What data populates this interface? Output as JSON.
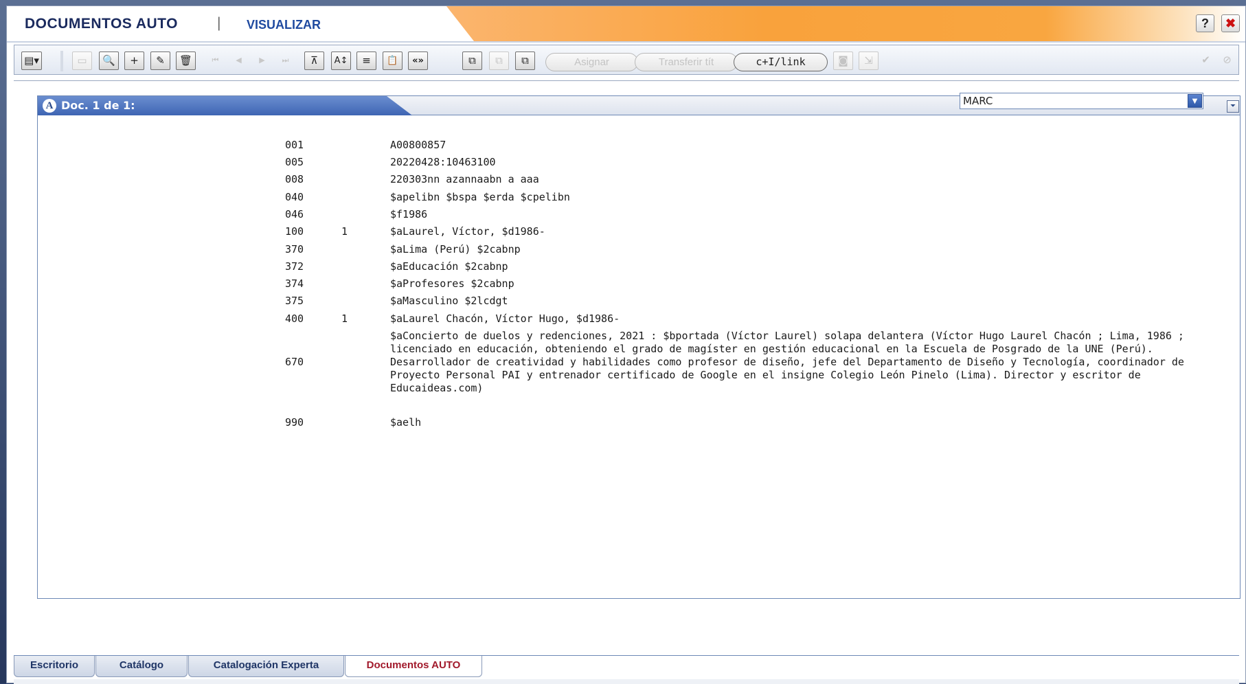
{
  "window": {
    "title": "DOCUMENTOS AUTO",
    "separator": "|",
    "mode": "VISUALIZAR",
    "help_label": "?",
    "close_label": "✖"
  },
  "toolbar": {
    "tools": [
      {
        "name": "view-menu-icon",
        "glyph": "▤▾",
        "enabled": true
      },
      {
        "name": "new-window-icon",
        "glyph": "▭",
        "enabled": false
      },
      {
        "name": "search-icon",
        "glyph": "🔍",
        "enabled": true
      },
      {
        "name": "add-icon",
        "glyph": "+",
        "enabled": true
      },
      {
        "name": "edit-icon",
        "glyph": "✎",
        "enabled": true
      },
      {
        "name": "delete-icon",
        "glyph": "🗑",
        "enabled": true
      },
      {
        "name": "first-record-icon",
        "glyph": "⏮",
        "enabled": false
      },
      {
        "name": "previous-record-icon",
        "glyph": "◀",
        "enabled": false
      },
      {
        "name": "next-record-icon",
        "glyph": "▶",
        "enabled": false
      },
      {
        "name": "last-record-icon",
        "glyph": "⏭",
        "enabled": false
      },
      {
        "name": "filter-icon",
        "glyph": "⊼",
        "enabled": true
      },
      {
        "name": "sort-icon",
        "glyph": "A↕",
        "enabled": true
      },
      {
        "name": "expand-list-icon",
        "glyph": "≡",
        "enabled": true
      },
      {
        "name": "paste-icon",
        "glyph": "📋",
        "enabled": true
      },
      {
        "name": "toggle-format-icon",
        "glyph": "«»",
        "enabled": true
      },
      {
        "name": "copy-record-icon",
        "glyph": "⧉",
        "enabled": true
      },
      {
        "name": "merge-record-icon",
        "glyph": "⧉",
        "enabled": false
      },
      {
        "name": "duplicate-record-icon",
        "glyph": "⧉",
        "enabled": true
      }
    ],
    "asignar_label": "Asignar",
    "transferir_label": "Transferir tít",
    "link_label": "c+I/link"
  },
  "panel": {
    "doc_icon": "A",
    "doc_label": "Doc. 1 de 1:",
    "format_value": "MARC"
  },
  "marc": [
    {
      "tag": "001",
      "ind": "",
      "value": "A00800857"
    },
    {
      "tag": "005",
      "ind": "",
      "value": "20220428:10463100"
    },
    {
      "tag": "008",
      "ind": "",
      "value": "220303nn azannaabn a aaa"
    },
    {
      "tag": "040",
      "ind": "",
      "value": "$apelibn $bspa $erda $cpelibn"
    },
    {
      "tag": "046",
      "ind": "",
      "value": "$f1986"
    },
    {
      "tag": "100",
      "ind": "1",
      "value": "$aLaurel, Víctor, $d1986-"
    },
    {
      "tag": "370",
      "ind": "",
      "value": "$aLima (Perú) $2cabnp"
    },
    {
      "tag": "372",
      "ind": "",
      "value": "$aEducación $2cabnp"
    },
    {
      "tag": "374",
      "ind": "",
      "value": "$aProfesores $2cabnp"
    },
    {
      "tag": "375",
      "ind": "",
      "value": "$aMasculino $2lcdgt"
    },
    {
      "tag": "400",
      "ind": "1",
      "value": "$aLaurel Chacón, Víctor Hugo, $d1986-"
    },
    {
      "tag": "670",
      "ind": "",
      "value": "$aConcierto de duelos y redenciones, 2021 : $bportada (Víctor Laurel) solapa delantera (Víctor Hugo Laurel Chacón ; Lima, 1986 ; licenciado en educación, obteniendo el grado de magíster en gestión educacional en la Escuela de Posgrado de la UNE (Perú). Desarrollador de creatividad y habilidades como profesor de diseño, jefe del Departamento de Diseño y Tecnología, coordinador de Proyecto Personal PAI y entrenador certificado de Google en el insigne Colegio León Pinelo (Lima). Director y escritor de Educaideas.com)"
    },
    {
      "tag": "990",
      "ind": "",
      "value": "$aelh"
    }
  ],
  "bottom_tabs": [
    {
      "label": "Escritorio",
      "active": false
    },
    {
      "label": "Catálogo",
      "active": false
    },
    {
      "label": "Catalogación Experta",
      "active": false
    },
    {
      "label": "Documentos AUTO",
      "active": true
    }
  ],
  "colors": {
    "title_text": "#1a2a5e",
    "accent_orange": "#f9a23c",
    "panel_blue": "#3e65b3",
    "active_tab_text": "#a1192b"
  }
}
